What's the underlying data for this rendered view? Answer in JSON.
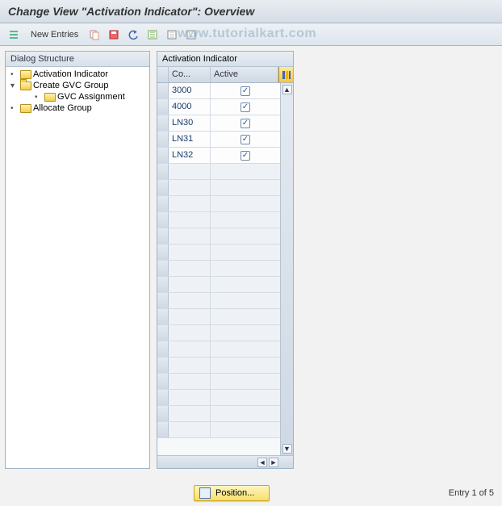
{
  "title": "Change View \"Activation Indicator\": Overview",
  "toolbar": {
    "new_entries": "New Entries"
  },
  "watermark": "www.tutorialkart.com",
  "tree": {
    "header": "Dialog Structure",
    "items": [
      {
        "label": "Activation Indicator",
        "level": 0,
        "open": false,
        "leaf": true
      },
      {
        "label": "Create GVC Group",
        "level": 0,
        "open": true,
        "leaf": false
      },
      {
        "label": "GVC Assignment",
        "level": 1,
        "open": false,
        "leaf": true
      },
      {
        "label": "Allocate Group",
        "level": 0,
        "open": false,
        "leaf": true
      }
    ]
  },
  "table": {
    "title": "Activation Indicator",
    "col_code": "Co...",
    "col_active": "Active",
    "rows": [
      {
        "code": "3000",
        "active": true
      },
      {
        "code": "4000",
        "active": true
      },
      {
        "code": "LN30",
        "active": true
      },
      {
        "code": "LN31",
        "active": true
      },
      {
        "code": "LN32",
        "active": true
      }
    ],
    "blank_rows": 17
  },
  "footer": {
    "position_label": "Position...",
    "entry_text": "Entry 1 of 5"
  }
}
